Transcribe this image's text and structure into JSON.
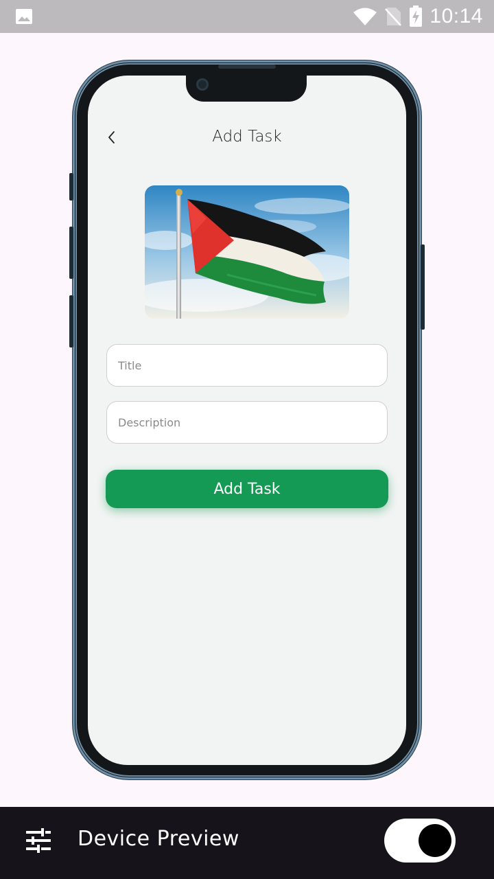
{
  "status_bar": {
    "time": "10:14",
    "icons": [
      "gallery-icon",
      "wifi-icon",
      "no-sim-icon",
      "battery-charging-icon"
    ]
  },
  "app": {
    "title": "Add Task",
    "back_icon": "chevron-left-icon",
    "title_field": {
      "placeholder": "Title",
      "value": ""
    },
    "description_field": {
      "placeholder": "Description",
      "value": ""
    },
    "submit_label": "Add Task",
    "accent_color": "#149a54"
  },
  "device_preview": {
    "label": "Device Preview",
    "settings_icon": "tune-icon",
    "enabled": true
  }
}
